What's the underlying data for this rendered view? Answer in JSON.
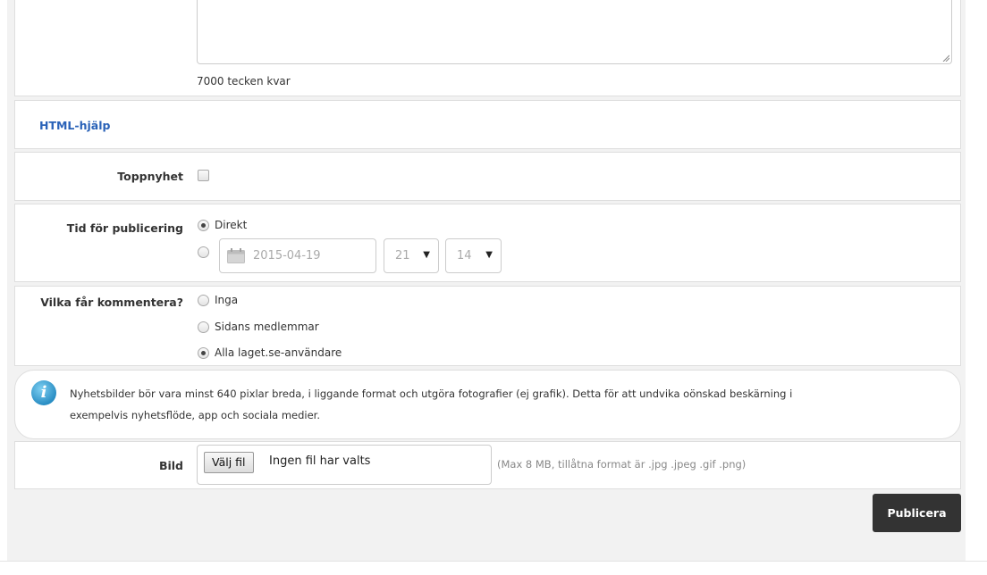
{
  "message": {
    "chars_left": "7000 tecken kvar"
  },
  "html_help": {
    "link": "HTML-hjälp"
  },
  "top_news": {
    "label": "Toppnyhet",
    "checked": false
  },
  "publish_time": {
    "label": "Tid för publicering",
    "option_direct": "Direkt",
    "date_value": "2015-04-19",
    "hour_value": "21",
    "minute_value": "14"
  },
  "comments": {
    "label": "Vilka får kommentera?",
    "options": [
      "Inga",
      "Sidans medlemmar",
      "Alla laget.se-användare"
    ],
    "selected": "Alla laget.se-användare"
  },
  "info": {
    "text_line1": "Nyhetsbilder bör vara minst 640 pixlar breda, i liggande format och utgöra fotografier (ej grafik). Detta för att undvika oönskad beskärning i",
    "text_line2": "exempelvis nyhetsflöde, app och sociala medier."
  },
  "image": {
    "label": "Bild",
    "choose_button": "Välj fil",
    "no_file": "Ingen fil har valts",
    "hint": "(Max 8 MB, tillåtna format är .jpg .jpeg .gif .png)"
  },
  "actions": {
    "publish": "Publicera"
  }
}
